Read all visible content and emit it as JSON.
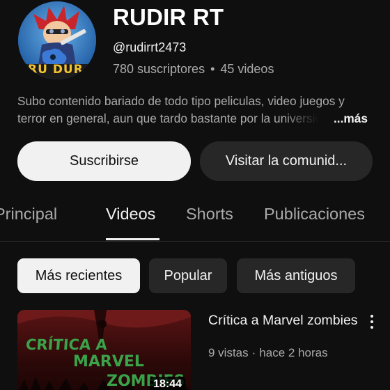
{
  "channel": {
    "name": "RUDIR RT",
    "handle": "@rudirrt2473",
    "subscribers": "780 suscriptores",
    "separator": "•",
    "video_count": "45 videos",
    "avatar_text": "RU DUR",
    "avatar_icon": "guitar-character-avatar"
  },
  "description": {
    "line1": "Subo contenido bariado de todo tipo peliculas, video juegos y",
    "line2": "terror en general, aun que tardo bastante por la universidad",
    "more": "...más"
  },
  "actions": {
    "subscribe": "Suscribirse",
    "community": "Visitar la comunid..."
  },
  "tabs": [
    {
      "label": "Principal",
      "active": false
    },
    {
      "label": "Videos",
      "active": true
    },
    {
      "label": "Shorts",
      "active": false
    },
    {
      "label": "Publicaciones",
      "active": false
    }
  ],
  "filters": [
    {
      "label": "Más recientes",
      "selected": true
    },
    {
      "label": "Popular",
      "selected": false
    },
    {
      "label": "Más antiguos",
      "selected": false
    }
  ],
  "videos": [
    {
      "title": "Crítica a Marvel zombies",
      "views": "9 vistas",
      "meta_separator": "·",
      "age": "hace 2 horas",
      "duration": "18:44",
      "thumbnail_text": [
        "CRÍTICA A",
        "MARVEL",
        "ZOMBIES"
      ]
    }
  ],
  "colors": {
    "background": "#0f0f0f",
    "primary_text": "#f1f1f1",
    "secondary_text": "#aaaaaa",
    "chip_bg": "#272727",
    "thumbnail_text_green": "#3aa34a"
  }
}
